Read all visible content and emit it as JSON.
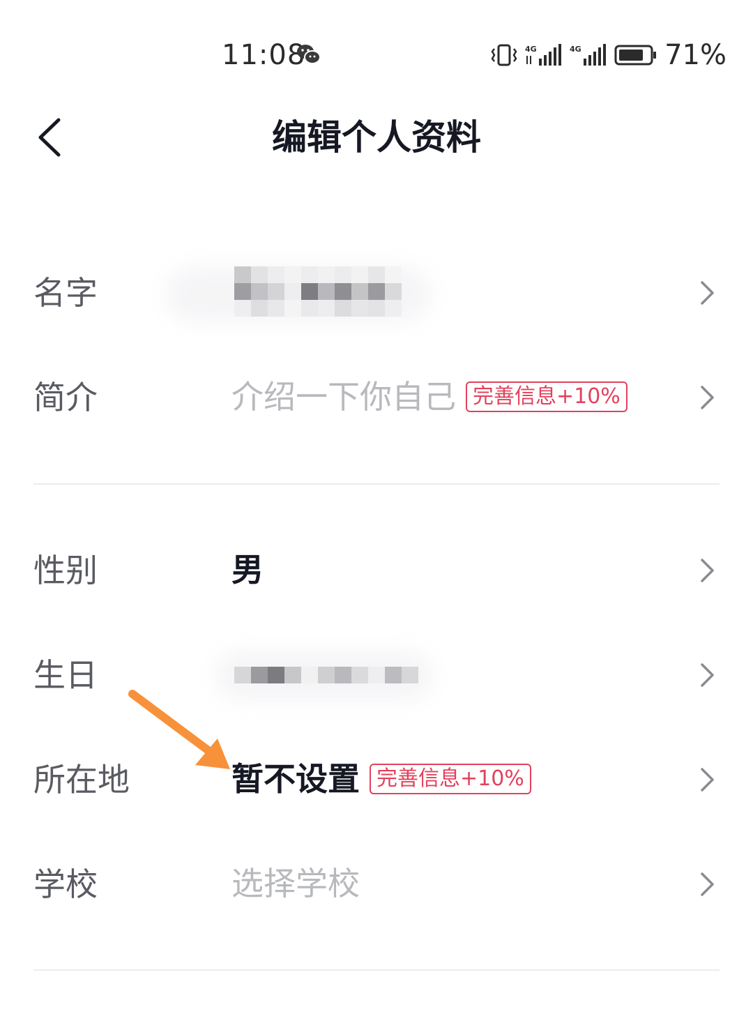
{
  "status_bar": {
    "time": "11:08",
    "battery": "71%"
  },
  "header": {
    "title": "编辑个人资料"
  },
  "rows": [
    {
      "label": "名字",
      "value": "",
      "value_style": "redacted",
      "badge": ""
    },
    {
      "label": "简介",
      "value": "介绍一下你自己",
      "value_style": "placeholder",
      "badge": "完善信息+10%"
    },
    {
      "label": "性别",
      "value": "男",
      "value_style": "strong",
      "badge": ""
    },
    {
      "label": "生日",
      "value": "",
      "value_style": "redacted",
      "badge": ""
    },
    {
      "label": "所在地",
      "value": "暂不设置",
      "value_style": "strong",
      "badge": "完善信息+10%"
    },
    {
      "label": "学校",
      "value": "选择学校",
      "value_style": "placeholder",
      "badge": ""
    }
  ],
  "colors": {
    "badge": "#e2415d",
    "arrow": "#f7913a",
    "placeholder": "#b8b9bd",
    "label": "#5a5b62"
  }
}
